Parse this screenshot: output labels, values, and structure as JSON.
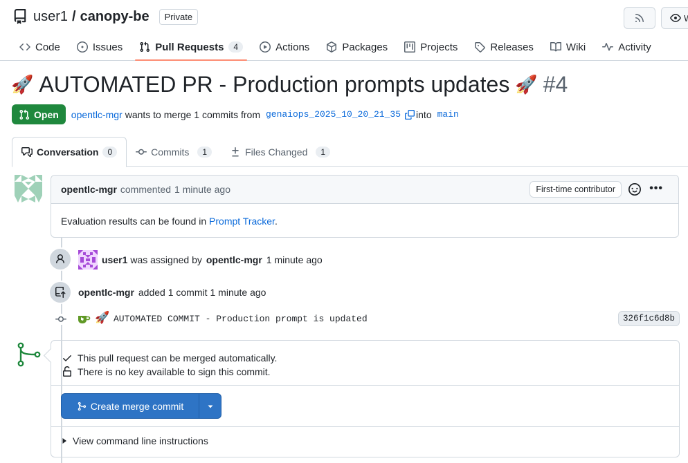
{
  "repo": {
    "owner": "user1",
    "separator": "/",
    "name": "canopy-be",
    "visibility": "Private"
  },
  "header_buttons": {
    "watch_label": "W"
  },
  "nav": {
    "tabs": [
      {
        "label": "Code",
        "icon": "code-icon"
      },
      {
        "label": "Issues",
        "icon": "issue-icon"
      },
      {
        "label": "Pull Requests",
        "icon": "pull-request-icon",
        "count": "4",
        "active": true
      },
      {
        "label": "Actions",
        "icon": "play-icon"
      },
      {
        "label": "Packages",
        "icon": "package-icon"
      },
      {
        "label": "Projects",
        "icon": "project-icon"
      },
      {
        "label": "Releases",
        "icon": "tag-icon"
      },
      {
        "label": "Wiki",
        "icon": "book-icon"
      },
      {
        "label": "Activity",
        "icon": "pulse-icon"
      }
    ]
  },
  "pr": {
    "title": "AUTOMATED PR - Production prompts updates",
    "number": "#4",
    "state": "Open",
    "author": "opentlc-mgr",
    "merge_text": "wants to merge 1 commits from",
    "head_branch": "genaiops_2025_10_20_21_35",
    "into_text": "into",
    "base_branch": "main"
  },
  "subtabs": [
    {
      "label": "Conversation",
      "count": "0",
      "active": true
    },
    {
      "label": "Commits",
      "count": "1"
    },
    {
      "label": "Files Changed",
      "count": "1"
    }
  ],
  "comment": {
    "author": "opentlc-mgr",
    "action": "commented",
    "time": "1 minute ago",
    "badge": "First-time contributor",
    "body_prefix": "Evaluation results can be found in",
    "body_link": "Prompt Tracker",
    "body_suffix": "."
  },
  "events": {
    "assigned": {
      "assignee": "user1",
      "text": "was assigned by",
      "actor": "opentlc-mgr",
      "time": "1 minute ago"
    },
    "commit_added": {
      "actor": "opentlc-mgr",
      "text": "added 1 commit",
      "time": "1 minute ago"
    },
    "commit": {
      "message": "AUTOMATED COMMIT - Production prompt is updated",
      "sha": "326f1c6d8b"
    }
  },
  "merge": {
    "status_line1": "This pull request can be merged automatically.",
    "status_line2": "There is no key available to sign this commit.",
    "button_label": "Create merge commit",
    "cli_label": "View command line instructions"
  },
  "colors": {
    "accent": "#0969da",
    "open_green": "#1f883d",
    "merge_button": "#2e74c5",
    "active_tab_underline": "#fd8c73"
  }
}
